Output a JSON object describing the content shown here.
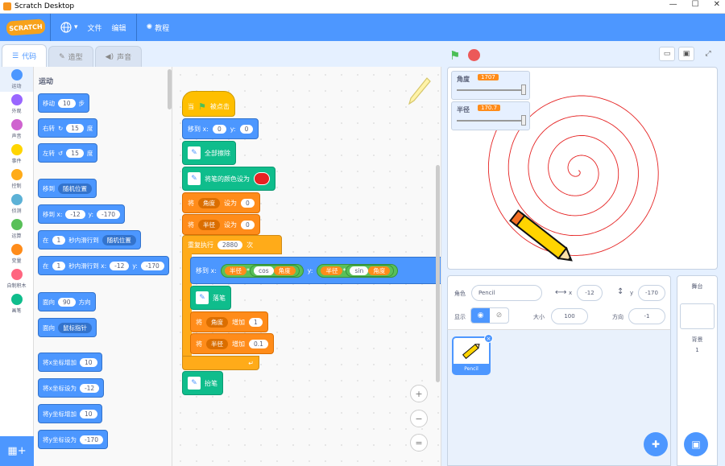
{
  "window": {
    "title": "Scratch Desktop",
    "min": "—",
    "max": "☐",
    "close": "✕"
  },
  "menu": {
    "logo": "SCRATCH",
    "lang_icon": "globe-icon",
    "file": "文件",
    "edit": "编辑",
    "tutorial": "教程"
  },
  "tabs": [
    {
      "label": "代码"
    },
    {
      "label": "造型"
    },
    {
      "label": "声音"
    }
  ],
  "categories": [
    {
      "label": "运动",
      "color": "#4c97ff"
    },
    {
      "label": "外观",
      "color": "#9966ff"
    },
    {
      "label": "声音",
      "color": "#cf63cf"
    },
    {
      "label": "事件",
      "color": "#ffd500"
    },
    {
      "label": "控制",
      "color": "#ffab19"
    },
    {
      "label": "侦测",
      "color": "#5cb1d6"
    },
    {
      "label": "运算",
      "color": "#59c059"
    },
    {
      "label": "变量",
      "color": "#ff8c1a"
    },
    {
      "label": "自制积木",
      "color": "#ff6680"
    },
    {
      "label": "画笔",
      "color": "#0fbd8c"
    }
  ],
  "palette": {
    "title": "运动",
    "move": {
      "a": "移动",
      "v": "10",
      "b": "步"
    },
    "turn_right": {
      "a": "右转",
      "v": "15",
      "b": "度"
    },
    "turn_left": {
      "a": "左转",
      "v": "15",
      "b": "度"
    },
    "goto": {
      "a": "移到",
      "dd": "随机位置"
    },
    "goto_xy": {
      "a": "移到 x:",
      "x": "-12",
      "b": "y:",
      "y": "-170"
    },
    "glide": {
      "a": "在",
      "v": "1",
      "b": "秒内滑行到",
      "dd": "随机位置"
    },
    "glide_xy": {
      "a": "在",
      "v": "1",
      "b": "秒内滑行到 x:",
      "x": "-12",
      "c": "y:",
      "y": "-170"
    },
    "point": {
      "a": "面向",
      "v": "90",
      "b": "方向"
    },
    "point_to": {
      "a": "面向",
      "dd": "鼠标指针"
    },
    "change_x": {
      "a": "将x坐标增加",
      "v": "10"
    },
    "set_x": {
      "a": "将x坐标设为",
      "v": "-12"
    },
    "change_y": {
      "a": "将y坐标增加",
      "v": "10"
    },
    "set_y": {
      "a": "将y坐标设为",
      "v": "-170"
    }
  },
  "script": {
    "hat": {
      "a": "当",
      "b": "被点击"
    },
    "goto": {
      "a": "移到 x:",
      "x": "0",
      "b": "y:",
      "y": "0"
    },
    "clear": "全部擦除",
    "set_color": "将笔的颜色设为",
    "set_angle": {
      "a": "将",
      "var": "角度",
      "b": "设为",
      "v": "0"
    },
    "set_radius": {
      "a": "将",
      "var": "半径",
      "b": "设为",
      "v": "0"
    },
    "repeat": {
      "a": "重复执行",
      "v": "2880",
      "b": "次"
    },
    "inner_goto": {
      "a": "移到 x:",
      "r1": "半径",
      "mul1": "*",
      "f1": "cos",
      "ang1": "角度",
      "b": "y:",
      "r2": "半径",
      "mul2": "*",
      "f2": "sin",
      "ang2": "角度"
    },
    "pen_down": "落笔",
    "change_angle": {
      "a": "将",
      "var": "角度",
      "b": "增加",
      "v": "1"
    },
    "change_radius": {
      "a": "将",
      "var": "半径",
      "b": "增加",
      "v": "0.1"
    },
    "pen_up": "抬笔"
  },
  "zoom": {
    "in": "+",
    "out": "−",
    "reset": "="
  },
  "monitors": [
    {
      "name": "角度",
      "value": "1707"
    },
    {
      "name": "半径",
      "value": "170.7"
    }
  ],
  "sprite": {
    "name_label": "角色",
    "name": "Pencil",
    "x_label": "x",
    "x": "-12",
    "y_label": "y",
    "y": "-170",
    "show_label": "显示",
    "size_label": "大小",
    "size": "100",
    "dir_label": "方向",
    "dir": "-1",
    "thumb_name": "Pencil",
    "delete": "×"
  },
  "stage_pane": {
    "title": "舞台",
    "backdrops_label": "背景",
    "backdrops": "1"
  },
  "colors": {
    "accent": "#4d97ff",
    "pen_red": "#e52222"
  }
}
